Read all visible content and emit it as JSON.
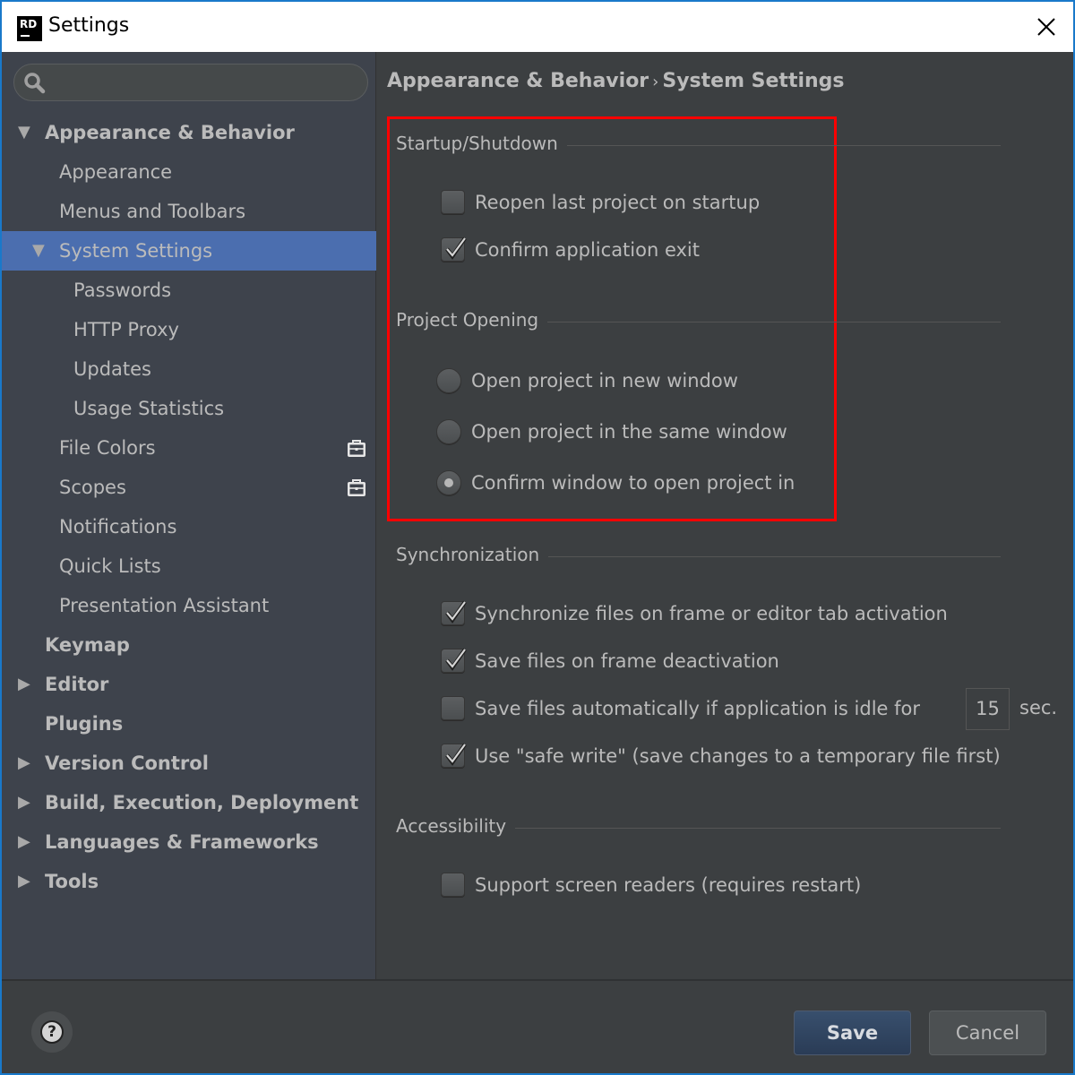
{
  "window": {
    "title": "Settings",
    "logo_text": "RD",
    "close_icon": "close-icon"
  },
  "search": {
    "placeholder": "",
    "value": "",
    "icon": "search-icon"
  },
  "sidebar": {
    "items": [
      {
        "label": "Appearance & Behavior",
        "level": 0,
        "bold": true,
        "expander": "expanded",
        "selected": false
      },
      {
        "label": "Appearance",
        "level": 1,
        "bold": false,
        "expander": "none",
        "selected": false
      },
      {
        "label": "Menus and Toolbars",
        "level": 1,
        "bold": false,
        "expander": "none",
        "selected": false
      },
      {
        "label": "System Settings",
        "level": 1,
        "bold": false,
        "expander": "expanded",
        "selected": true
      },
      {
        "label": "Passwords",
        "level": 2,
        "bold": false,
        "expander": "none",
        "selected": false
      },
      {
        "label": "HTTP Proxy",
        "level": 2,
        "bold": false,
        "expander": "none",
        "selected": false
      },
      {
        "label": "Updates",
        "level": 2,
        "bold": false,
        "expander": "none",
        "selected": false
      },
      {
        "label": "Usage Statistics",
        "level": 2,
        "bold": false,
        "expander": "none",
        "selected": false
      },
      {
        "label": "File Colors",
        "level": 1,
        "bold": false,
        "expander": "none",
        "selected": false,
        "badge": "project-level-icon"
      },
      {
        "label": "Scopes",
        "level": 1,
        "bold": false,
        "expander": "none",
        "selected": false,
        "badge": "project-level-icon"
      },
      {
        "label": "Notifications",
        "level": 1,
        "bold": false,
        "expander": "none",
        "selected": false
      },
      {
        "label": "Quick Lists",
        "level": 1,
        "bold": false,
        "expander": "none",
        "selected": false
      },
      {
        "label": "Presentation Assistant",
        "level": 1,
        "bold": false,
        "expander": "none",
        "selected": false
      },
      {
        "label": "Keymap",
        "level": 0,
        "bold": true,
        "expander": "none",
        "selected": false
      },
      {
        "label": "Editor",
        "level": 0,
        "bold": true,
        "expander": "collapsed",
        "selected": false
      },
      {
        "label": "Plugins",
        "level": 0,
        "bold": true,
        "expander": "none",
        "selected": false
      },
      {
        "label": "Version Control",
        "level": 0,
        "bold": true,
        "expander": "collapsed",
        "selected": false
      },
      {
        "label": "Build, Execution, Deployment",
        "level": 0,
        "bold": true,
        "expander": "collapsed",
        "selected": false
      },
      {
        "label": "Languages & Frameworks",
        "level": 0,
        "bold": true,
        "expander": "collapsed",
        "selected": false
      },
      {
        "label": "Tools",
        "level": 0,
        "bold": true,
        "expander": "collapsed",
        "selected": false
      }
    ]
  },
  "content": {
    "breadcrumb": {
      "parent": "Appearance & Behavior",
      "separator": "›",
      "current": "System Settings"
    },
    "groups": {
      "startup": {
        "title": "Startup/Shutdown",
        "options": [
          {
            "label": "Reopen last project on startup",
            "checked": false
          },
          {
            "label": "Confirm application exit",
            "checked": true
          }
        ]
      },
      "project_opening": {
        "title": "Project Opening",
        "options": [
          {
            "label": "Open project in new window",
            "selected": false
          },
          {
            "label": "Open project in the same window",
            "selected": false
          },
          {
            "label": "Confirm window to open project in",
            "selected": true
          }
        ]
      },
      "sync": {
        "title": "Synchronization",
        "options": [
          {
            "label": "Synchronize files on frame or editor tab activation",
            "checked": true
          },
          {
            "label": "Save files on frame deactivation",
            "checked": true
          },
          {
            "label": "Save files automatically if application is idle for",
            "checked": false
          },
          {
            "label": "Use \"safe write\" (save changes to a temporary file first)",
            "checked": true
          }
        ],
        "idle_seconds": "15",
        "idle_unit": "sec."
      },
      "accessibility": {
        "title": "Accessibility",
        "options": [
          {
            "label": "Support screen readers (requires restart)",
            "checked": false
          }
        ]
      }
    },
    "highlight_color": "#ff0000"
  },
  "footer": {
    "help_icon": "help-icon",
    "help_glyph": "?",
    "save_label": "Save",
    "cancel_label": "Cancel"
  },
  "colors": {
    "selection": "#4b6eaf",
    "sidebar_bg": "#3e434c",
    "content_bg": "#3c3f41",
    "text": "#bbbbbb",
    "window_border": "#1979ca"
  }
}
